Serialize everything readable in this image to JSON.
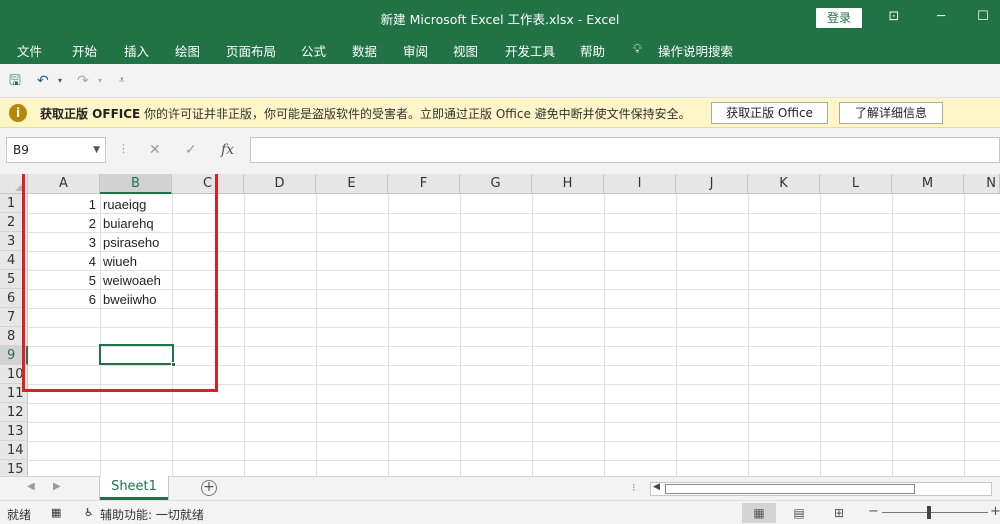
{
  "window": {
    "title": "新建 Microsoft Excel 工作表.xlsx  -  Excel",
    "login_label": "登录",
    "controls": [
      "ribbon-display-icon",
      "minimize-icon",
      "maximize-icon"
    ]
  },
  "menu": {
    "items": [
      "文件",
      "开始",
      "插入",
      "绘图",
      "页面布局",
      "公式",
      "数据",
      "审阅",
      "视图",
      "开发工具",
      "帮助"
    ],
    "tell_me": "操作说明搜索"
  },
  "qat": {
    "icons": [
      "save-icon",
      "undo-icon",
      "redo-icon",
      "customize-icon"
    ]
  },
  "infobar": {
    "title": "获取正版 OFFICE",
    "message": "你的许可证并非正版，你可能是盗版软件的受害者。立即通过正版 Office 避免中断并使文件保持安全。",
    "primary_button": "获取正版 Office",
    "secondary_button": "了解详细信息"
  },
  "formula_bar": {
    "name_box": "B9",
    "fx": "fx",
    "value": ""
  },
  "grid": {
    "columns": [
      "A",
      "B",
      "C",
      "D",
      "E",
      "F",
      "G",
      "H",
      "I",
      "J",
      "K",
      "L",
      "M",
      "N"
    ],
    "rows": [
      "1",
      "2",
      "3",
      "4",
      "5",
      "6",
      "7",
      "8",
      "9",
      "10",
      "11",
      "12",
      "13",
      "14",
      "15"
    ],
    "selected_column": "B",
    "selected_row": "9",
    "data": [
      {
        "a": "1",
        "b": "ruaeiqg"
      },
      {
        "a": "2",
        "b": "buiarehq"
      },
      {
        "a": "3",
        "b": "psiraseho"
      },
      {
        "a": "4",
        "b": "wiueh"
      },
      {
        "a": "5",
        "b": "weiwoaeh"
      },
      {
        "a": "6",
        "b": "bweiiwho"
      }
    ]
  },
  "sheets": {
    "tabs": [
      "Sheet1"
    ],
    "active": "Sheet1"
  },
  "status": {
    "ready": "就绪",
    "accessibility": "辅助功能: 一切就绪"
  },
  "colors": {
    "accent": "#217346",
    "highlight": "#e02020",
    "infobar_bg": "#fff6c8"
  }
}
